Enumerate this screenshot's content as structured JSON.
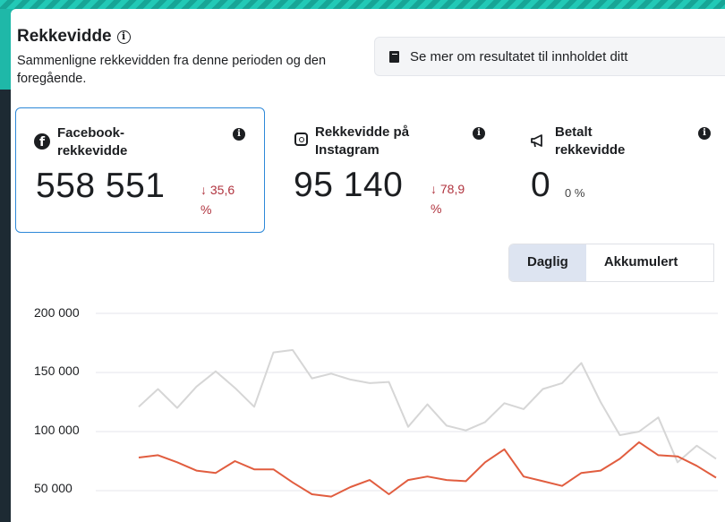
{
  "header": {
    "title": "Rekkevidde",
    "subtitle": "Sammenligne rekkevidden fra denne perioden og den foregående.",
    "more_button": "Se mer om resultatet til innholdet ditt"
  },
  "cards": [
    {
      "label": "Facebook-rekkevidde",
      "value": "558 551",
      "change": "↓ 35,6 %",
      "icon": "facebook-icon",
      "selected": true
    },
    {
      "label": "Rekkevidde på Instagram",
      "value": "95 140",
      "change": "↓ 78,9 %",
      "icon": "instagram-icon"
    },
    {
      "label": "Betalt rekkevidde",
      "value": "0",
      "change": "0 %",
      "icon": "megaphone-icon"
    }
  ],
  "toggle": {
    "daily": "Daglig",
    "cumulative": "Akkumulert",
    "selected": "Daglig"
  },
  "colors": {
    "current": "#e15d3f",
    "previous": "#d6d6d6",
    "accent": "#2d88d8",
    "negative": "#b0333e"
  },
  "chart_data": {
    "type": "line",
    "ylim": [
      25000,
      200000
    ],
    "yticks": [
      "200 000",
      "150 000",
      "100 000",
      "50 000"
    ],
    "ytick_values": [
      200000,
      150000,
      100000,
      50000
    ],
    "grid": true,
    "series": [
      {
        "values": [
          78000,
          80000,
          74000,
          67000,
          65000,
          75000,
          68000,
          68000,
          57000,
          47000,
          45000,
          53000,
          59000,
          47000,
          59000,
          62000,
          59000,
          58000,
          74000,
          85000,
          62000,
          58000,
          54000,
          65000,
          67000,
          77000,
          91000,
          80000,
          79000,
          71000,
          61000
        ]
      },
      {
        "values": [
          121000,
          136000,
          120000,
          138000,
          151000,
          137000,
          121000,
          167000,
          169000,
          145000,
          149000,
          144000,
          141000,
          142000,
          104000,
          123000,
          105000,
          101000,
          108000,
          124000,
          119000,
          136000,
          141000,
          158000,
          125000,
          97000,
          100000,
          112000,
          74000,
          88000,
          77000
        ]
      }
    ]
  }
}
